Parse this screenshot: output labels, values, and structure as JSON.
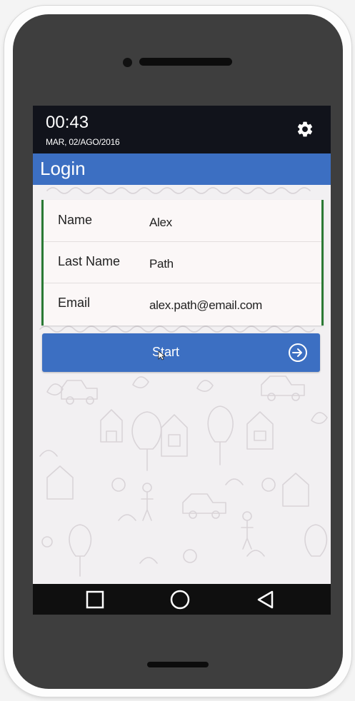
{
  "status_bar": {
    "time": "00:43",
    "date": "MAR, 02/AGO/2016",
    "settings_icon": "gear-icon"
  },
  "header": {
    "title": "Login"
  },
  "form": {
    "fields": [
      {
        "label": "Name",
        "value": "Alex"
      },
      {
        "label": "Last Name",
        "value": "Path"
      },
      {
        "label": "Email",
        "value": "alex.path@email.com"
      }
    ]
  },
  "start_button": {
    "label": "Start",
    "icon": "login-arrow-circle-icon"
  },
  "nav_bar": {
    "icons": [
      "recent-apps-icon",
      "home-icon",
      "back-icon"
    ]
  },
  "colors": {
    "accent_blue": "#3c6fc2",
    "status_bar": "#11131b",
    "field_border_green": "#2b7a35",
    "phone_body": "#3e3e3e"
  }
}
